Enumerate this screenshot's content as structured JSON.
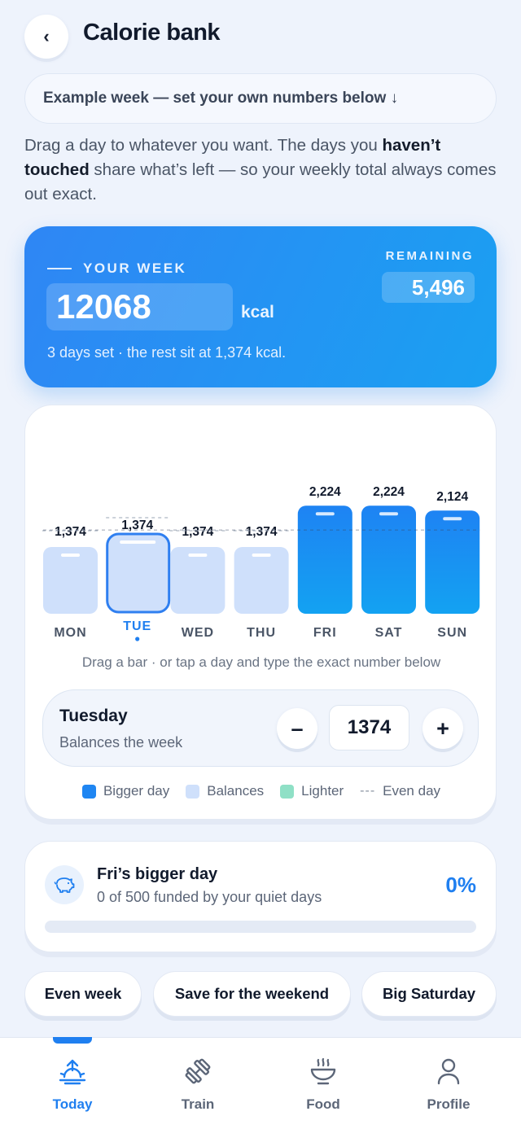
{
  "header": {
    "back_label": "‹",
    "title": "Calorie bank"
  },
  "example_banner": "Example week — set your own numbers below ↓",
  "intro": {
    "part1": "Drag a day to whatever you want. The days you ",
    "bold": "haven’t touched",
    "part2": " share what’s left — so your weekly total always comes out exact."
  },
  "week": {
    "label": "YOUR WEEK",
    "total": "12068",
    "unit": "kcal",
    "remaining_label": "REMAINING",
    "remaining_value": "5,496",
    "note": "3 days set · the rest sit at 1,374 kcal."
  },
  "colors": {
    "bigger": "#1f86f2",
    "balances": "#cfe0fb",
    "lighter": "#8fe0c6",
    "accent": "#1f7ff0"
  },
  "days": [
    {
      "label": "MON",
      "value": 1374,
      "value_label": "1,374",
      "kind": "balances",
      "selected": false
    },
    {
      "label": "TUE",
      "value": 1374,
      "value_label": "1,374",
      "kind": "balances",
      "selected": true
    },
    {
      "label": "WED",
      "value": 1374,
      "value_label": "1,374",
      "kind": "balances",
      "selected": false
    },
    {
      "label": "THU",
      "value": 1374,
      "value_label": "1,374",
      "kind": "balances",
      "selected": false
    },
    {
      "label": "FRI",
      "value": 2224,
      "value_label": "2,224",
      "kind": "bigger",
      "selected": false
    },
    {
      "label": "SAT",
      "value": 2224,
      "value_label": "2,224",
      "kind": "bigger",
      "selected": false
    },
    {
      "label": "SUN",
      "value": 2124,
      "value_label": "2,124",
      "kind": "bigger",
      "selected": false
    }
  ],
  "even_day_value": 1724,
  "chart_hint": "Drag a bar · or tap a day and type the exact number below",
  "editor": {
    "day": "Tuesday",
    "subtitle": "Balances the week",
    "minus": "–",
    "value": "1374",
    "plus": "+"
  },
  "legend": [
    {
      "label": "Bigger day",
      "kind": "bigger"
    },
    {
      "label": "Balances",
      "kind": "balances"
    },
    {
      "label": "Lighter",
      "kind": "lighter"
    },
    {
      "label": "Even day",
      "kind": "even"
    }
  ],
  "bank": {
    "icon": "piggy-bank-icon",
    "title": "Fri’s bigger day",
    "subtitle": "0 of 500 funded by your quiet days",
    "percent_label": "0%",
    "funded_fraction": 0
  },
  "presets": [
    "Even week",
    "Save for the weekend",
    "Big Saturday"
  ],
  "tabs": [
    {
      "label": "Today",
      "icon": "sunrise-icon",
      "active": true
    },
    {
      "label": "Train",
      "icon": "dumbbell-icon",
      "active": false
    },
    {
      "label": "Food",
      "icon": "bowl-icon",
      "active": false
    },
    {
      "label": "Profile",
      "icon": "person-icon",
      "active": false
    }
  ]
}
